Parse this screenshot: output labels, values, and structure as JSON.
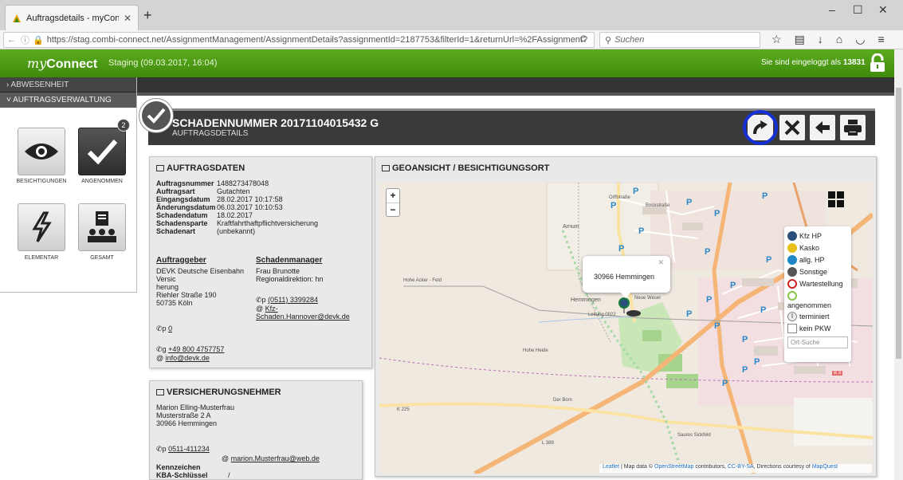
{
  "browser": {
    "tab_title": "Auftragsdetails - myConn...",
    "url": "https://stag.combi-connect.net/AssignmentManagement/AssignmentDetails?assignmentId=2187753&filterId=1&returnUrl=%2FAssignment?",
    "search_placeholder": "Suchen"
  },
  "header": {
    "logo_prefix": "my",
    "logo_suffix": "Connect",
    "staging": "Staging (09.03.2017, 16:04)",
    "login_text": "Sie sind eingeloggt als",
    "login_user": "13831"
  },
  "sidebar": {
    "menu1": "› ABWESENHEIT",
    "menu2": "˅ AUFTRAGSVERWALTUNG",
    "tiles": [
      {
        "label": "BESICHTIGUNGEN"
      },
      {
        "label": "ANGENOMMEN",
        "badge": "2"
      },
      {
        "label": "ELEMENTAR"
      },
      {
        "label": "GESAMT"
      }
    ]
  },
  "title": {
    "main": "SCHADENNUMMER 20171104015432 G",
    "sub": "AUFTRAGSDETAILS"
  },
  "auftrag": {
    "heading": "AUFTRAGSDATEN",
    "rows": [
      {
        "k": "Auftragsnummer",
        "v": "1488273478048"
      },
      {
        "k": "Auftragsart",
        "v": "Gutachten"
      },
      {
        "k": "Eingangsdatum",
        "v": "28.02.2017 10:17:58"
      },
      {
        "k": "Änderungsdatum",
        "v": "06.03.2017 10:10:53"
      },
      {
        "k": "Schadendatum",
        "v": "18.02.2017"
      },
      {
        "k": "Schadensparte",
        "v": "Kraftfahrthaftpflichtversicherung"
      },
      {
        "k": "Schadenart",
        "v": "(unbekannt)"
      }
    ],
    "auftraggeber_heading": "Auftraggeber",
    "auftraggeber": [
      "DEVK Deutsche Eisenbahn",
      "Versic",
      "herung",
      "Riehler Straße 190",
      "50735 Köln"
    ],
    "schadenmanager_heading": "Schadenmanager",
    "schadenmanager": [
      "Frau Brunotte",
      "Regionaldirektion: hn"
    ],
    "sm_phone": "(0511) 3399284",
    "sm_email": "Kfz-Schaden.Hannover@devk.de",
    "phone1": "0",
    "phone2": "+49 800 4757757",
    "email": "info@devk.de"
  },
  "versicherung": {
    "heading": "VERSICHERUNGSNEHMER",
    "lines": [
      "Marion Elling-Musterfrau",
      "Musterstraße 2 A",
      "30966 Hemmingen"
    ],
    "phone": "0511-411234",
    "email": "marion.Musterfrau@web.de",
    "kennzeichen_label": "Kennzeichen",
    "kba_label": "KBA-Schlüssel",
    "kba_value": "/"
  },
  "geo": {
    "heading": "GEOANSICHT / BESICHTIGUNGSORT",
    "popup_text": "30966 Hemmingen",
    "legend": [
      {
        "label": "Kfz HP",
        "color": "#2b4f7c"
      },
      {
        "label": "Kasko",
        "color": "#e8c11a"
      },
      {
        "label": "allg. HP",
        "color": "#1e87c8"
      },
      {
        "label": "Sonstige",
        "color": "#555555"
      },
      {
        "label": "Wartestellung",
        "color": "#cc2222"
      },
      {
        "label": "angenommen",
        "color": "#8bc34a"
      }
    ],
    "terminiert": "terminiert",
    "kein_pkw": "kein PKW",
    "ort_suche": "Ort-Suche",
    "attribution_leaflet": "Leaflet",
    "attribution_mid": "| Map data ©",
    "attribution_osm": "OpenStreetMap",
    "attribution_contrib": "contributors,",
    "attribution_cc": "CC-BY-SA",
    "attribution_dir": ", Directions courtesy of",
    "attribution_mq": "MapQuest",
    "labels": {
      "arnum": "Arnum",
      "hemmingen": "Hemmingen",
      "neue_weser": "Neue Weser",
      "hohe_acker": "Hohe Acker - Feld",
      "hohe_heide": "Hohe Heide",
      "der_born": "Der Born",
      "k225": "K 225",
      "l389": "L 389",
      "b3": "B 3",
      "leitung": "Leitung 0022",
      "orffstrasse": "Orffstraße",
      "bockstrasse": "Bockstraße",
      "saures_sickfeld": "Saures Sickfeld"
    }
  }
}
